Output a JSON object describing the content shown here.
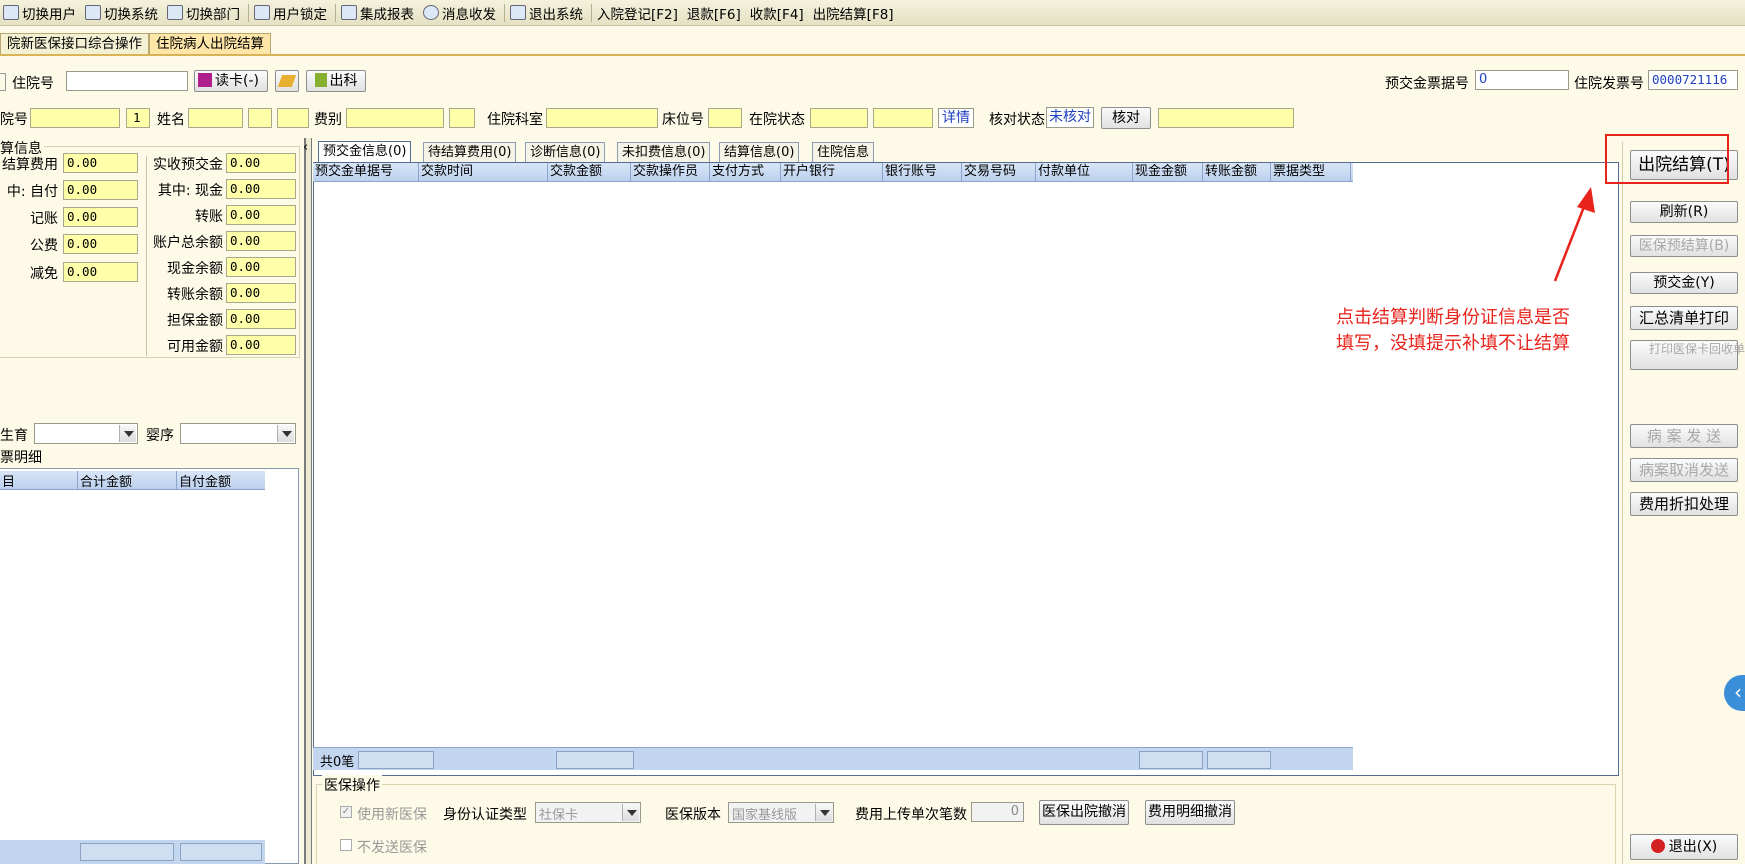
{
  "toolbar": {
    "items": [
      "切换用户",
      "切换系统",
      "切换部门",
      "用户锁定",
      "集成报表",
      "消息收发",
      "退出系统"
    ],
    "shortcuts": [
      "入院登记[F2]",
      "退款[F6]",
      "收款[F4]",
      "出院结算[F8]"
    ]
  },
  "main_tabs": [
    "院新医保接口综合操作",
    "住院病人出院结算"
  ],
  "row1": {
    "hosp_no_label": "住院号",
    "hosp_no_value": "",
    "read_card": "读卡(-)",
    "discharge": "出科",
    "deposit_no_label": "预交金票据号",
    "deposit_no_value": "0",
    "invoice_no_label": "住院发票号",
    "invoice_no_value": "0000721116"
  },
  "row2": {
    "hosp_no_label": "院号",
    "bed_count": "1",
    "name_label": "姓名",
    "fee_type_label": "费别",
    "dept_label": "住院科室",
    "bed_label": "床位号",
    "status_label": "在院状态",
    "detail_link": "详情",
    "check_status_label": "核对状态",
    "check_status_value": "未核对",
    "check_button": "核对"
  },
  "settle": {
    "group_title": "算信息",
    "left": [
      {
        "label": "结算费用",
        "value": "0.00"
      },
      {
        "label": "中: 自付",
        "value": "0.00"
      },
      {
        "label": "记账",
        "value": "0.00"
      },
      {
        "label": "公费",
        "value": "0.00"
      },
      {
        "label": "减免",
        "value": "0.00"
      }
    ],
    "right": [
      {
        "label": "实收预交金",
        "value": "0.00"
      },
      {
        "label": "其中: 现金",
        "value": "0.00"
      },
      {
        "label": "转账",
        "value": "0.00"
      },
      {
        "label": "账户总余额",
        "value": "0.00"
      },
      {
        "label": "现金余额",
        "value": "0.00"
      },
      {
        "label": "转账余额",
        "value": "0.00"
      },
      {
        "label": "担保金额",
        "value": "0.00"
      },
      {
        "label": "可用金额",
        "value": "0.00"
      }
    ]
  },
  "birth": {
    "label": "生育",
    "value": "",
    "baby_label": "婴序",
    "baby_value": ""
  },
  "invoice_detail": {
    "title": "票明细",
    "columns": [
      "目",
      "合计金额",
      "自付金额"
    ]
  },
  "detail_tabs": [
    "预交金信息(0)",
    "待结算费用(0)",
    "诊断信息(0)",
    "未扣费信息(0)",
    "结算信息(0)",
    "住院信息"
  ],
  "grid": {
    "columns": [
      "预交金单据号",
      "交款时间",
      "交款金额",
      "交款操作员",
      "支付方式",
      "开户银行",
      "银行账号",
      "交易号码",
      "付款单位",
      "现金金额",
      "转账金额",
      "票据类型"
    ],
    "footer": "共0笔"
  },
  "insurance": {
    "title": "医保操作",
    "use_new": "使用新医保",
    "no_send": "不发送医保",
    "id_type_label": "身份认证类型",
    "id_type_value": "社保卡",
    "version_label": "医保版本",
    "version_value": "国家基线版",
    "upload_label": "费用上传单次笔数",
    "upload_value": "0",
    "cancel_discharge": "医保出院撤消",
    "cancel_detail": "费用明细撤消"
  },
  "side_buttons": {
    "settle": "出院结算(T)",
    "refresh": "刷新(R)",
    "pre_settle": "医保预结算(B)",
    "deposit": "预交金(Y)",
    "summary_print": "汇总清单打印",
    "print_card": "打印医保卡回收单",
    "case_send": "病 案 发 送",
    "case_cancel": "病案取消发送",
    "discount": "费用折扣处理",
    "exit": "退出(X)"
  },
  "annotation": {
    "line1": "点击结算判断身份证信息是否",
    "line2": "填写，没填提示补填不让结算",
    "color": "#e8231b"
  }
}
